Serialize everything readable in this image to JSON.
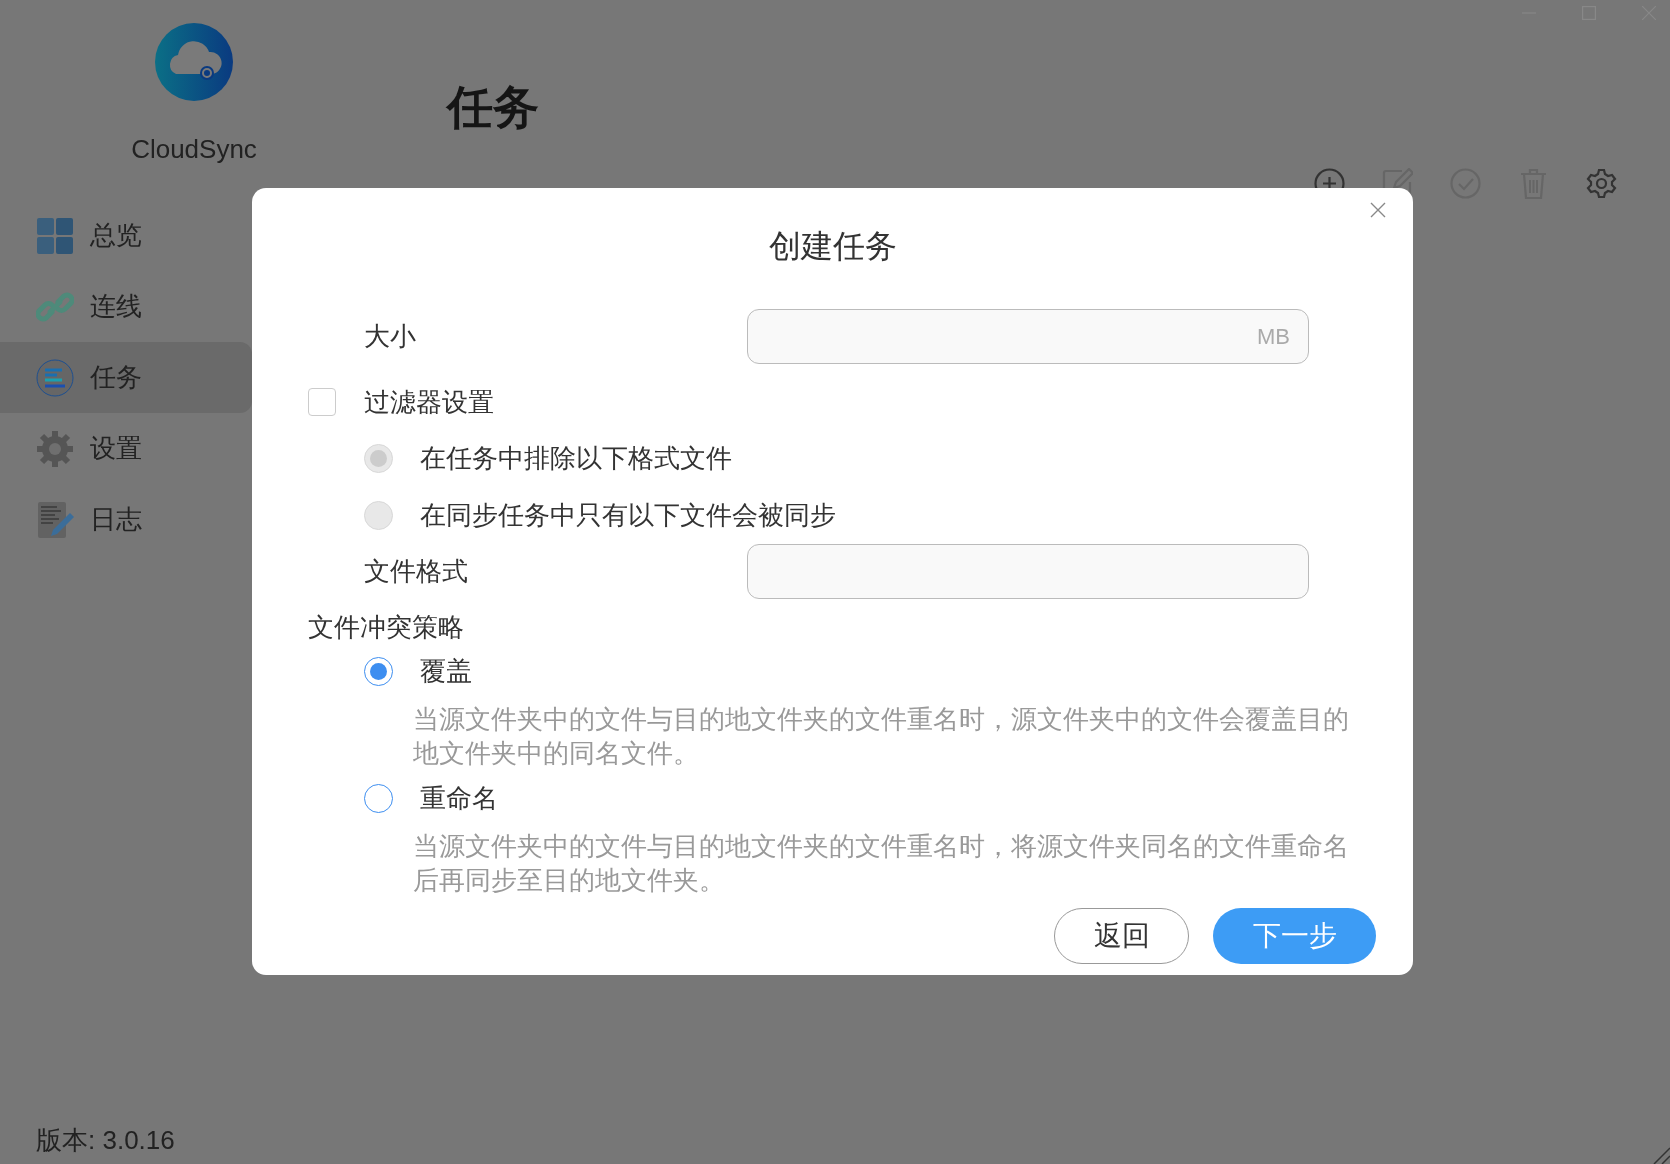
{
  "sidebar": {
    "app_name": "CloudSync",
    "items": [
      {
        "label": "总览",
        "selected": false
      },
      {
        "label": "连线",
        "selected": false
      },
      {
        "label": "任务",
        "selected": true
      },
      {
        "label": "设置",
        "selected": false
      },
      {
        "label": "日志",
        "selected": false
      }
    ],
    "version": "版本: 3.0.16"
  },
  "page": {
    "title": "任务"
  },
  "dialog": {
    "title": "创建任务",
    "size": {
      "label": "大小",
      "unit": "MB"
    },
    "filter": {
      "label": "过滤器设置",
      "checked": false,
      "options": [
        {
          "label": "在任务中排除以下格式文件",
          "selected": true,
          "disabled": true
        },
        {
          "label": "在同步任务中只有以下文件会被同步",
          "selected": false,
          "disabled": true
        }
      ]
    },
    "file_format": {
      "label": "文件格式"
    },
    "conflict": {
      "label": "文件冲突策略",
      "options": [
        {
          "label": "覆盖",
          "selected": true,
          "description": "当源文件夹中的文件与目的地文件夹的文件重名时，源文件夹中的文件会覆盖目的地文件夹中的同名文件。"
        },
        {
          "label": "重命名",
          "selected": false,
          "description": "当源文件夹中的文件与目的地文件夹的文件重名时，将源文件夹同名的文件重命名后再同步至目的地文件夹。"
        }
      ]
    },
    "buttons": [
      {
        "label": "返回",
        "kind": "secondary"
      },
      {
        "label": "下一步",
        "kind": "primary"
      }
    ]
  }
}
